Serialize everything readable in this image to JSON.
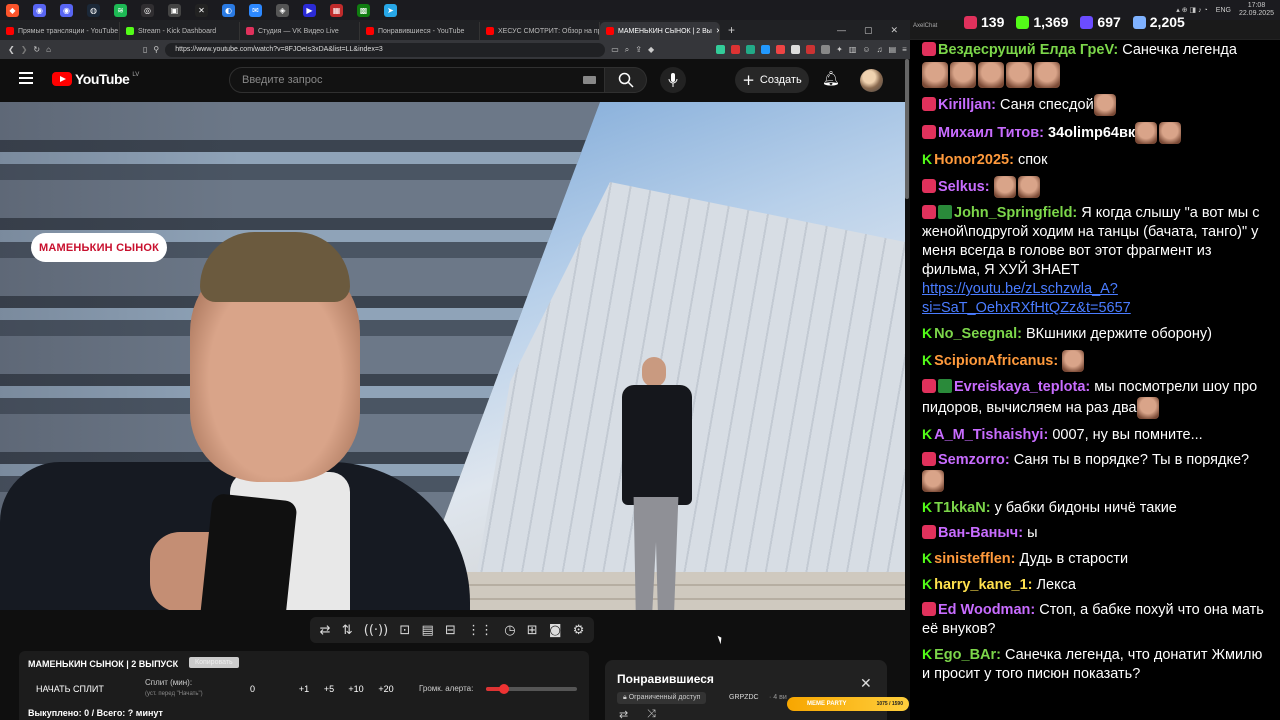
{
  "taskbar": {
    "icons": [
      {
        "name": "brave-icon",
        "color": "#fb542b",
        "glyph": "◆"
      },
      {
        "name": "discord-icon",
        "color": "#5865f2",
        "glyph": "◉"
      },
      {
        "name": "discord-icon-2",
        "color": "#5865f2",
        "glyph": "◉"
      },
      {
        "name": "steam-icon",
        "color": "#1b2838",
        "glyph": "◍"
      },
      {
        "name": "spotify-icon",
        "color": "#1db954",
        "glyph": "≋"
      },
      {
        "name": "obs-icon",
        "color": "#302e31",
        "glyph": "◎"
      },
      {
        "name": "app-icon",
        "color": "#444",
        "glyph": "▣"
      },
      {
        "name": "x-icon",
        "color": "#222",
        "glyph": "✕"
      },
      {
        "name": "browser-icon",
        "color": "#2a7ae2",
        "glyph": "◐"
      },
      {
        "name": "chat-icon",
        "color": "#2c88ff",
        "glyph": "✉"
      },
      {
        "name": "app-icon-2",
        "color": "#555",
        "glyph": "◈"
      },
      {
        "name": "media-icon",
        "color": "#2b2bd6",
        "glyph": "▶"
      },
      {
        "name": "media-icon-2",
        "color": "#c02b2b",
        "glyph": "▦"
      },
      {
        "name": "xbox-icon",
        "color": "#107c10",
        "glyph": "▩"
      },
      {
        "name": "telegram-icon",
        "color": "#27a7e7",
        "glyph": "➤"
      }
    ],
    "lang": "ENG",
    "time": "17:08",
    "date": "22.09.2025"
  },
  "browser": {
    "tabs": [
      {
        "label": "Прямые трансляции - YouTube Stu",
        "color": "#ff0000",
        "active": false
      },
      {
        "label": "Stream - Kick Dashboard",
        "color": "#53fc18",
        "active": false
      },
      {
        "label": "Студия — VK Видео Live",
        "color": "#e0315c",
        "active": false
      },
      {
        "label": "Понравившиеся - YouTube",
        "color": "#ff0000",
        "active": false
      },
      {
        "label": "ХЕСУС СМОТРИТ: Обзор на пропа",
        "color": "#ff0000",
        "active": false
      },
      {
        "label": "МАМЕНЬКИН СЫНОК | 2 Вы",
        "color": "#ff0000",
        "active": true
      }
    ],
    "new_tab": "+",
    "url": "https://www.youtube.com/watch?v=8FJOeIs3xDA&list=LL&index=3"
  },
  "youtube": {
    "logo_text": "YouTube",
    "region": "LV",
    "search_placeholder": "Введите запрос",
    "create_label": "Создать"
  },
  "video": {
    "badge": "МАМЕНЬКИН СЫНОК"
  },
  "player_tools": [
    "⇄",
    "⇅",
    "((·))",
    "⊡",
    "▤",
    "⊟",
    "⋮⋮",
    "◷",
    "⊞",
    "◙",
    "⚙"
  ],
  "split_panel": {
    "title": "МАМЕНЬКИН СЫНОК | 2 ВЫПУСК",
    "copy_label": "Копировать",
    "start_label": "НАЧАТЬ СПЛИТ",
    "split_min": "Сплит (мин):",
    "split_hint": "(уст. перед \"Начать\")",
    "values": [
      "0",
      "+1",
      "+5",
      "+10",
      "+20"
    ],
    "alert_label": "Громк. алерта:",
    "alert_level": 0.2,
    "bought": "Выкуплено: 0 / Всего: ? минут"
  },
  "liked_panel": {
    "title": "Понравившиеся",
    "access": "Ограниченный доступ",
    "owner": "GRPZDC",
    "meta": "· 4 ви"
  },
  "meme_bar": {
    "label": "MEME PARTY",
    "count": "1075 / 1590"
  },
  "chat_header": {
    "app": "AxelChat",
    "stats": [
      {
        "name": "vk-viewers",
        "value": "139",
        "color": "#e0315c"
      },
      {
        "name": "kick-viewers",
        "value": "1,369",
        "color": "#53fc18"
      },
      {
        "name": "youtube-viewers",
        "value": "697",
        "color": "#6b4cff"
      },
      {
        "name": "total-viewers",
        "value": "2,205",
        "color": "#7fb2ff"
      }
    ]
  },
  "chat": [
    {
      "platform": "vk",
      "check": false,
      "nick": "Вездесрущий Елда ГреV:",
      "color": "#7cd64a",
      "text": "Санечка легенда",
      "emotes": 5,
      "emote_block": true
    },
    {
      "platform": "vk",
      "check": false,
      "nick": "Kirilljan:",
      "color": "#c86cff",
      "text": "Саня спесдой",
      "emotes": 1
    },
    {
      "platform": "vk",
      "check": false,
      "nick": "Михаил Титов:",
      "color": "#c86cff",
      "text": "34olimp64вк",
      "bold_text": true,
      "emotes": 2
    },
    {
      "platform": "kick",
      "check": false,
      "nick": "Honor2025:",
      "color": "#ff9a3c",
      "text": "спок",
      "emotes": 0
    },
    {
      "platform": "vk",
      "check": false,
      "nick": "Selkus:",
      "color": "#c86cff",
      "text": "",
      "emotes": 2
    },
    {
      "platform": "vk",
      "check": true,
      "nick": "John_Springfield:",
      "color": "#7cd64a",
      "text": "Я когда слышу \"а вот мы с женой\\подругой ходим на танцы (бачата, танго)\" у меня всегда в голове вот этот фрагмент из фильма, Я ХУЙ ЗНАЕТ",
      "link": "https://youtu.be/zLschzwla_A?si=SaT_OehxRXfHtQZz&t=5657",
      "emotes": 0
    },
    {
      "platform": "kick",
      "check": false,
      "nick": "No_Seegnal:",
      "color": "#7cd64a",
      "text": "ВКшники держите оборону)",
      "emotes": 0
    },
    {
      "platform": "kick",
      "check": false,
      "nick": "ScipionAfricanus:",
      "color": "#ff9a3c",
      "text": "",
      "emotes": 1
    },
    {
      "platform": "vk",
      "check": true,
      "nick": "Evreiskaya_teplota:",
      "color": "#c86cff",
      "text": "мы посмотрели шоу про пидоров, вычисляем на раз два",
      "emotes": 1
    },
    {
      "platform": "kick",
      "check": false,
      "nick": "A_M_Tishaishyi:",
      "color": "#c86cff",
      "text": "0007, ну вы помните...",
      "emotes": 0
    },
    {
      "platform": "vk",
      "check": false,
      "nick": "Semzorro:",
      "color": "#c86cff",
      "text": "Саня ты в порядке? Ты в порядке?",
      "emotes": 1
    },
    {
      "platform": "kick",
      "check": false,
      "nick": "T1kkaN:",
      "color": "#7cd64a",
      "text": "у бабки бидоны ничё такие",
      "emotes": 0
    },
    {
      "platform": "vk",
      "check": false,
      "nick": "Ван-Ваныч:",
      "color": "#c86cff",
      "text": "ы",
      "emotes": 0
    },
    {
      "platform": "kick",
      "check": false,
      "nick": "sinistefflen:",
      "color": "#ff9a3c",
      "text": "Дудь в старости",
      "emotes": 0
    },
    {
      "platform": "kick",
      "check": false,
      "nick": "harry_kane_1:",
      "color": "#ffe14d",
      "text": "Лекса",
      "emotes": 0
    },
    {
      "platform": "vk",
      "check": false,
      "nick": "Ed Woodman:",
      "color": "#c86cff",
      "text": "Стоп, а бабке похуй что она мать её внуков?",
      "emotes": 0
    },
    {
      "platform": "kick",
      "check": false,
      "nick": "Ego_BAr:",
      "color": "#7cd64a",
      "text": "Санечка легенда, что донатит Жмилю и просит у того писюн показать?",
      "emotes": 0
    }
  ]
}
